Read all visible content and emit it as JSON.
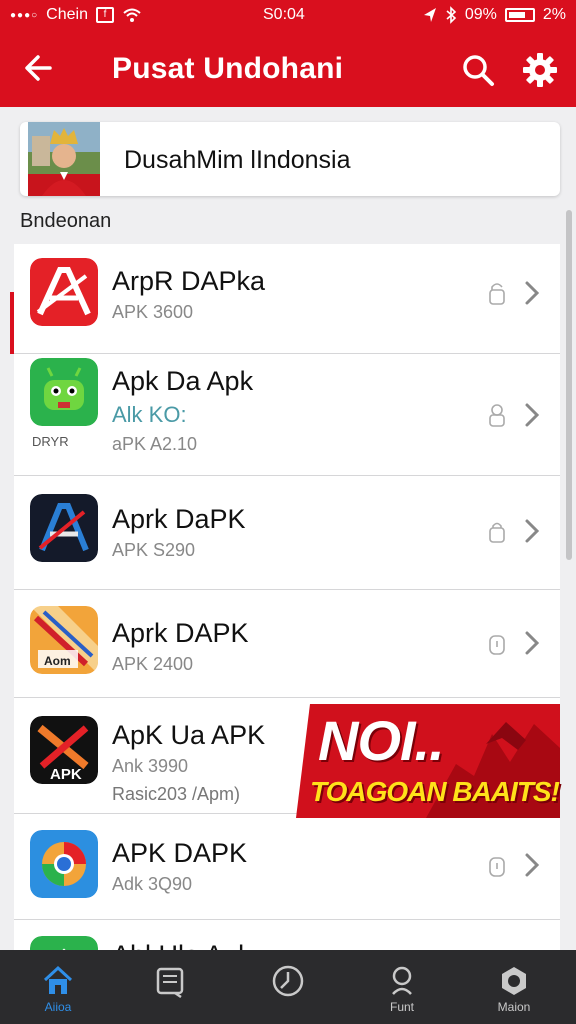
{
  "status_bar": {
    "carrier": "Chein",
    "time": "S0:04",
    "battery": "09%",
    "battery_pct": "2%"
  },
  "header": {
    "title": "Pusat Undohani"
  },
  "profile": {
    "name": "DusahMim lIndonsia"
  },
  "section_label": "Bndeonan",
  "apps": [
    {
      "name": "ArpR DAPka",
      "sub": "APK 3600"
    },
    {
      "name": "Apk Da Apk",
      "sub": "Alk KO:",
      "sub2": "aPK A2.10",
      "icon_label": "DRYR"
    },
    {
      "name": "Aprk DaPK",
      "sub": "APK S290"
    },
    {
      "name": "Aprk DAPK",
      "sub": "APK 2400",
      "icon_label": "Aom"
    },
    {
      "name": "ApK Ua APK",
      "sub": "Ank 3990",
      "sub2": "Rasic203 /Apm)",
      "icon_label": "APK"
    },
    {
      "name": "APK DAPK",
      "sub": "Adk 3Q90"
    },
    {
      "name": "Ahl Ula Auk",
      "sub": ""
    }
  ],
  "promo": {
    "title": "NOI..",
    "subtitle": "TOAGOAN BAAITS!"
  },
  "bottom_nav": [
    {
      "label": "Aiioa",
      "icon": "home-icon",
      "active": true
    },
    {
      "label": "",
      "icon": "book-icon",
      "active": false
    },
    {
      "label": "",
      "icon": "clock-icon",
      "active": false
    },
    {
      "label": "Funt",
      "icon": "profile-icon",
      "active": false
    },
    {
      "label": "Maion",
      "icon": "settings-icon",
      "active": false
    }
  ],
  "colors": {
    "brand_red": "#d90f1e",
    "nav_bg": "#2b2b2d",
    "nav_active": "#2f8fe8",
    "promo_yellow": "#ffe21a"
  }
}
